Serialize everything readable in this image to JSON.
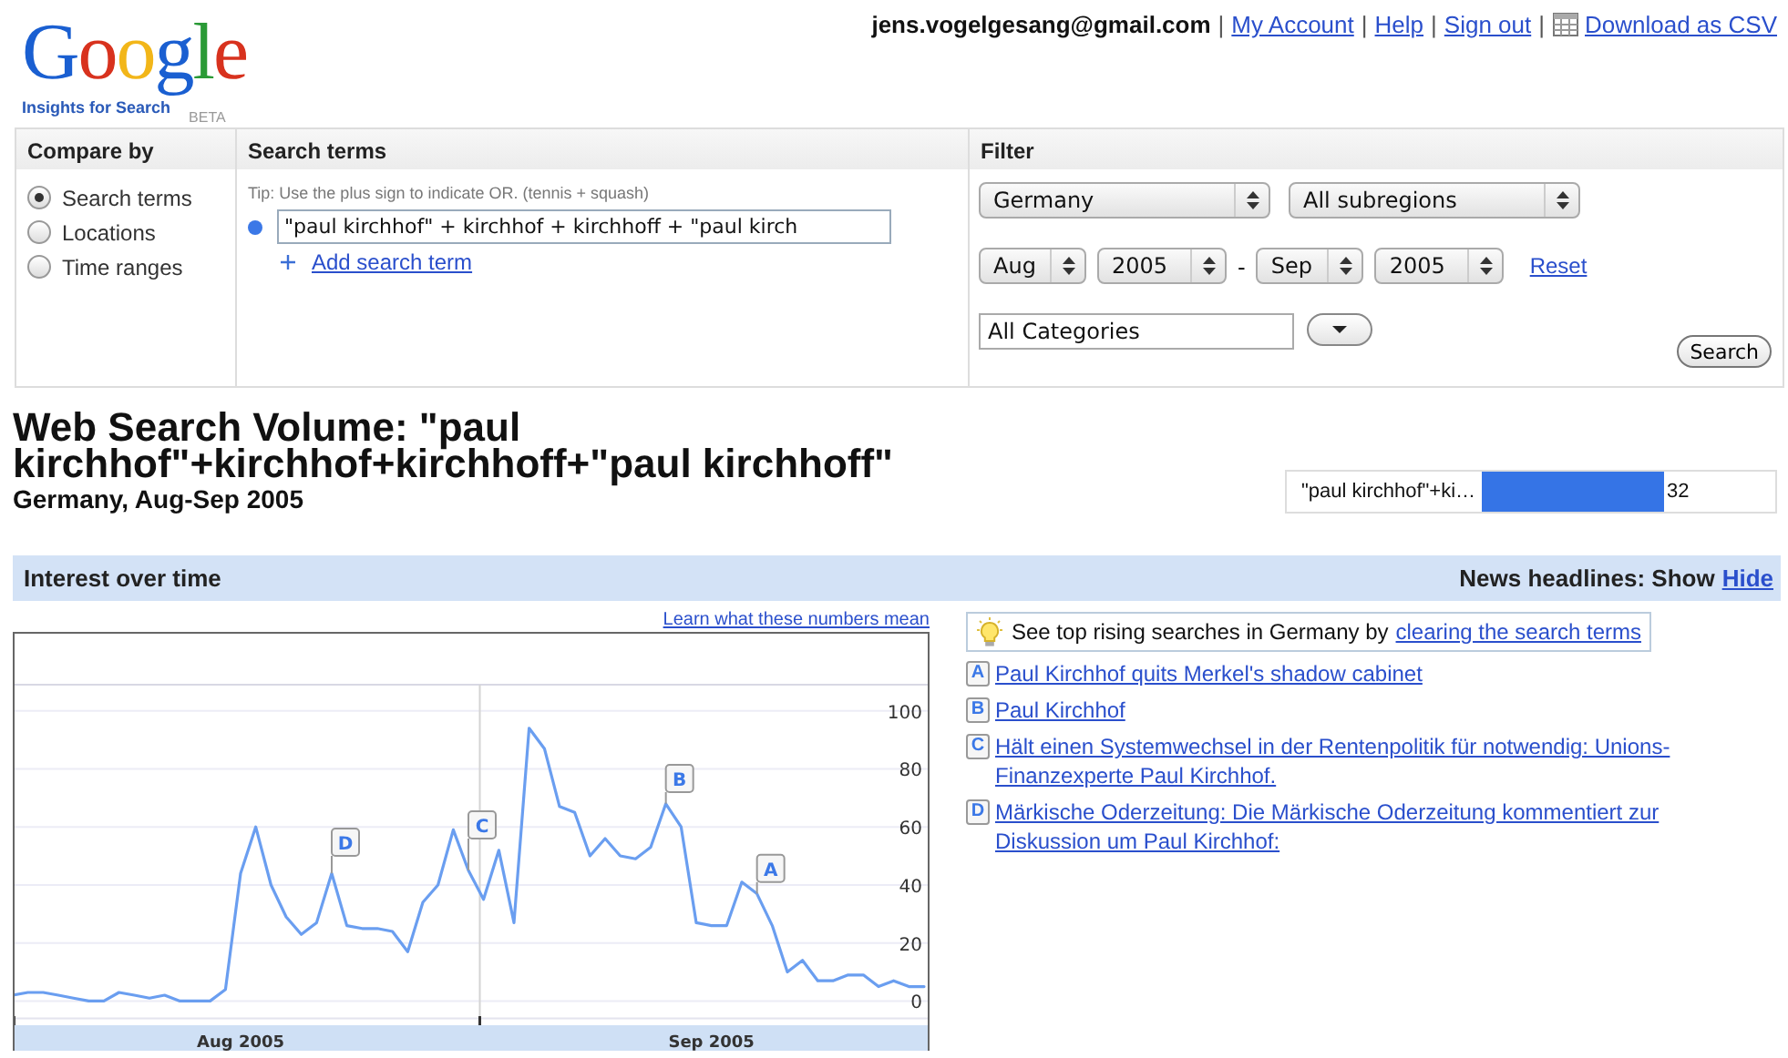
{
  "header": {
    "logo": {
      "title": "Google",
      "subtitle": "Insights for Search",
      "badge": "BETA"
    },
    "user": "jens.vogelgesang@gmail.com",
    "links": [
      "My Account",
      "Help",
      "Sign out"
    ],
    "separators": [
      "|",
      "|",
      "|",
      "|"
    ],
    "download": "Download as CSV"
  },
  "panel": {
    "compare_by": {
      "heading": "Compare by",
      "options": [
        {
          "label": "Search terms",
          "selected": true
        },
        {
          "label": "Locations",
          "selected": false
        },
        {
          "label": "Time ranges",
          "selected": false
        }
      ]
    },
    "search_terms": {
      "heading": "Search terms",
      "tip": "Tip: Use the plus sign to indicate OR. (tennis + squash)",
      "terms": [
        {
          "value": "\"paul kirchhof\" + kirchhof + kirchhoff + \"paul kirch",
          "color": "#3b78e7"
        }
      ],
      "add_link": "Add search term"
    },
    "filter": {
      "heading": "Filter",
      "location": "Germany",
      "subregion": "All subregions",
      "from_month": "Aug",
      "from_year": "2005",
      "separator": "-",
      "to_month": "Sep",
      "to_year": "2005",
      "reset": "Reset",
      "category": "All Categories",
      "search_button": "Search"
    }
  },
  "results": {
    "title": "Web Search Volume: \"paul kirchhof\"+kirchhof+kirchhoff+\"paul kirchhoff\"",
    "subtitle": "Germany, Aug-Sep 2005",
    "legend": {
      "label": "\"paul kirchhof\"+ki…",
      "value": "32"
    }
  },
  "band": {
    "title": "Interest over time",
    "news_label": "News headlines: Show",
    "hide_link": "Hide"
  },
  "chart": {
    "learn_link": "Learn what these numbers mean",
    "chart_data": {
      "type": "line",
      "categories": [
        null,
        null,
        null,
        null,
        null,
        null,
        null,
        null,
        null,
        null,
        null,
        null,
        null,
        null,
        null,
        "Aug 2005",
        null,
        null,
        null,
        null,
        null,
        null,
        null,
        null,
        null,
        null,
        null,
        null,
        null,
        null,
        null,
        null,
        null,
        null,
        null,
        null,
        null,
        null,
        null,
        null,
        null,
        null,
        null,
        null,
        null,
        null,
        "Sep 2005",
        null,
        null,
        null,
        null,
        null,
        null,
        null,
        null,
        null,
        null,
        null,
        null,
        null,
        null
      ],
      "series": [
        {
          "color": "#6a9ef0",
          "values": [
            2,
            3,
            3,
            2,
            1,
            0,
            0,
            3,
            2,
            1,
            2,
            0,
            0,
            0,
            4,
            44,
            60,
            40,
            29,
            23,
            27,
            44,
            26,
            25,
            25,
            24,
            17,
            34,
            40,
            59,
            45,
            35,
            52,
            27,
            94,
            87,
            67,
            65,
            50,
            56,
            50,
            49,
            53,
            68,
            60,
            27,
            26,
            26,
            41,
            37,
            26,
            10,
            14,
            7,
            7,
            9,
            9,
            5,
            7,
            5,
            5
          ]
        }
      ],
      "ylim": [
        -6,
        109
      ],
      "yticks": [
        0,
        20,
        40,
        60,
        80,
        100
      ],
      "grid": true,
      "annotations": [
        "D",
        "C",
        "B",
        "A"
      ]
    }
  },
  "news": {
    "tip": {
      "text": "See top rising searches in Germany by",
      "link": "clearing the search terms"
    },
    "headlines": [
      {
        "letter": "A",
        "text": "Paul Kirchhof quits Merkel's shadow cabinet"
      },
      {
        "letter": "B",
        "text": "Paul Kirchhof"
      },
      {
        "letter": "C",
        "text": "Hält einen Systemwechsel in der Rentenpolitik für notwendig: Unions-Finanzexperte Paul Kirchhof."
      },
      {
        "letter": "D",
        "text": "Märkische Oderzeitung: Die Märkische Oderzeitung kommentiert zur Diskussion um Paul Kirchhof:"
      }
    ]
  }
}
